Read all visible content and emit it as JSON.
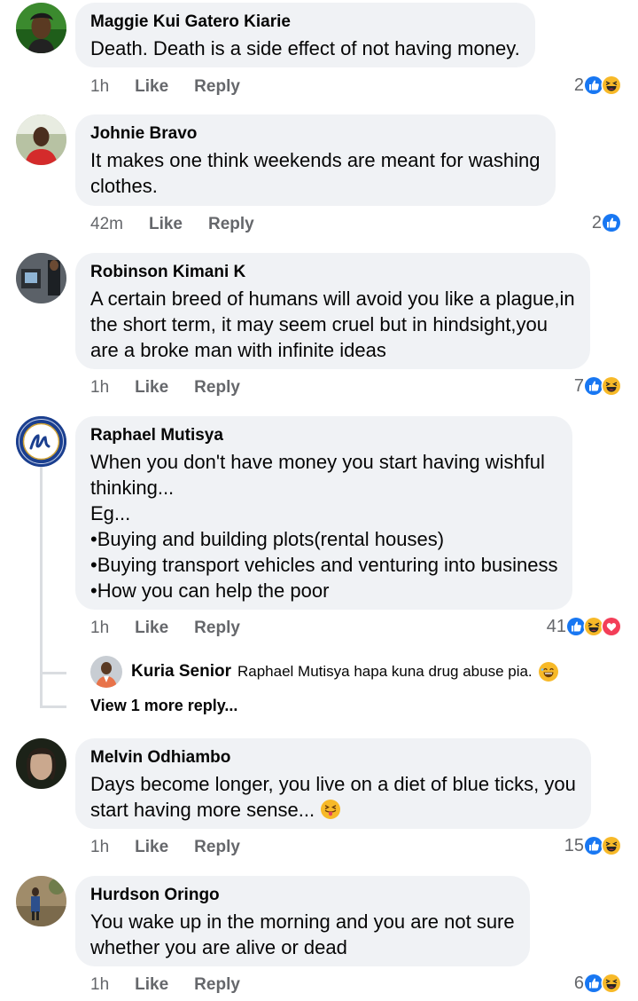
{
  "colors": {
    "like_blue": "#1877f2",
    "haha_yellow": "#f7b928",
    "love_red": "#f33e58",
    "meta_gray": "#65676b",
    "bubble_bg": "#f0f2f5"
  },
  "actions": {
    "like": "Like",
    "reply": "Reply"
  },
  "comments": [
    {
      "author": "Maggie Kui Gatero Kiarie",
      "lines": [
        "Death. Death is a side effect of not having money."
      ],
      "time": "1h",
      "reaction_count": "2",
      "reactions": [
        "like-icon",
        "haha-icon"
      ]
    },
    {
      "author": "Johnie Bravo",
      "lines": [
        "It makes one think weekends are meant for washing",
        "clothes."
      ],
      "time": "42m",
      "reaction_count": "2",
      "reactions": [
        "like-icon"
      ]
    },
    {
      "author": "Robinson Kimani K",
      "lines": [
        "A certain breed of humans will avoid you like a plague,in",
        "the short term, it may seem cruel but in hindsight,you",
        "are a broke man with infinite ideas"
      ],
      "time": "1h",
      "reaction_count": "7",
      "reactions": [
        "like-icon",
        "haha-icon"
      ]
    },
    {
      "author": "Raphael Mutisya",
      "lines": [
        "When you don't have money you start having wishful",
        "thinking...",
        "Eg...",
        "•Buying and building plots(rental houses)",
        "•Buying transport vehicles and venturing into business",
        "•How you can help the poor"
      ],
      "time": "1h",
      "reaction_count": "41",
      "reactions": [
        "like-icon",
        "haha-icon",
        "love-icon"
      ]
    },
    {
      "author": "Melvin Odhiambo",
      "lines": [
        "Days become longer, you live on a diet of blue ticks, you",
        "start having more sense..."
      ],
      "time": "1h",
      "reaction_count": "15",
      "reactions": [
        "like-icon",
        "haha-icon"
      ]
    },
    {
      "author": "Hurdson Oringo",
      "lines": [
        "You wake up in the morning and you are not sure",
        "whether you are alive or dead"
      ],
      "time": "1h",
      "reaction_count": "6",
      "reactions": [
        "like-icon",
        "haha-icon"
      ]
    }
  ],
  "reply": {
    "author": "Kuria Senior",
    "text": "Raphael Mutisya hapa kuna drug abuse pia."
  },
  "view_more": "View 1 more reply..."
}
